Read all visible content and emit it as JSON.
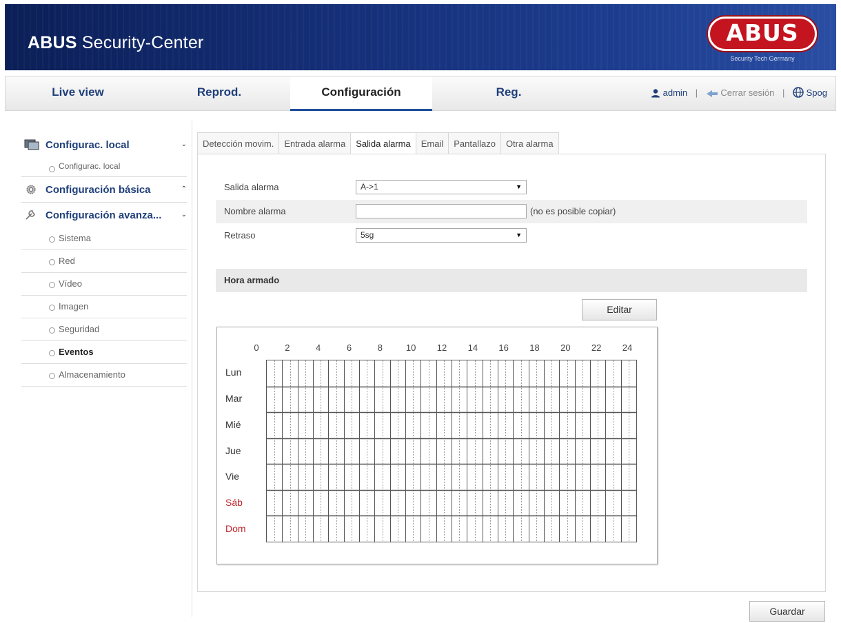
{
  "header": {
    "title_bold": "ABUS",
    "title_rest": " Security-Center",
    "logo_text": "ABUS",
    "logo_subtitle": "Security Tech Germany"
  },
  "nav": {
    "tabs": [
      {
        "label": "Live view",
        "active": false
      },
      {
        "label": "Reprod.",
        "active": false
      },
      {
        "label": "Configuración",
        "active": true
      },
      {
        "label": "Reg.",
        "active": false
      }
    ],
    "user": "admin",
    "logout": "Cerrar sesión",
    "language": "Spog"
  },
  "sidebar": {
    "sections": [
      {
        "label": "Configurac. local",
        "icon": "monitor-icon",
        "expanded": true
      },
      {
        "label": "Configuración básica",
        "icon": "gear-icon",
        "expanded": false
      },
      {
        "label": "Configuración avanza...",
        "icon": "wrench-icon",
        "expanded": true
      }
    ],
    "local_items": [
      "Configurac. local"
    ],
    "advanced_items": [
      "Sistema",
      "Red",
      "Vídeo",
      "Imagen",
      "Seguridad",
      "Eventos",
      "Almacenamiento"
    ],
    "active_item": "Eventos"
  },
  "subtabs": [
    "Detección movim.",
    "Entrada alarma",
    "Salida alarma",
    "Email",
    "Pantallazo",
    "Otra alarma"
  ],
  "active_subtab": "Salida alarma",
  "form": {
    "alarm_output_label": "Salida alarma",
    "alarm_output_value": "A->1",
    "alarm_name_label": "Nombre alarma",
    "alarm_name_value": "",
    "alarm_name_hint": "(no es posible copiar)",
    "delay_label": "Retraso",
    "delay_value": "5sg"
  },
  "schedule": {
    "section_title": "Hora armado",
    "edit_button": "Editar",
    "hours": [
      "0",
      "2",
      "4",
      "6",
      "8",
      "10",
      "12",
      "14",
      "16",
      "18",
      "20",
      "22",
      "24"
    ],
    "days": [
      "Lun",
      "Mar",
      "Mié",
      "Jue",
      "Vie",
      "Sáb",
      "Dom"
    ],
    "weekend_color": "#c0282d"
  },
  "save_button": "Guardar",
  "colors": {
    "brand_blue": "#1d3d8f",
    "logo_red": "#c41420",
    "nav_text": "#1f3f7a"
  }
}
